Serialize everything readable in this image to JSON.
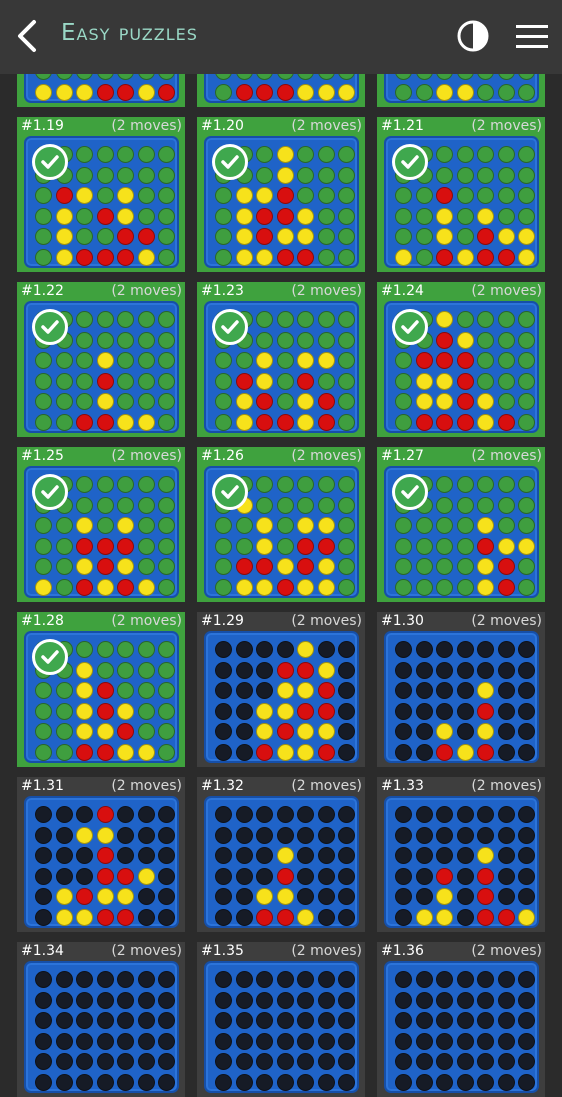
{
  "header": {
    "title": "Easy puzzles"
  },
  "colors": {
    "solved_bg": "#3fa23e",
    "unsolved_bg": "#3e3e3e",
    "board_blue": "#1f63c8",
    "red": "#d80f0f",
    "yellow": "#f7e21b",
    "title": "#9ad8c6"
  },
  "icons": {
    "back": "chevron-left-icon",
    "contrast": "contrast-icon",
    "menu": "hamburger-menu-icon",
    "solved": "check-circle-icon"
  },
  "puzzles": [
    {
      "number": "",
      "moves": "",
      "solved": true,
      "board": [
        "eeeeeee",
        "eeeeeee",
        "eeeeeee",
        "eeeeeee",
        "eeeeeee",
        "yyyrryr"
      ]
    },
    {
      "number": "",
      "moves": "",
      "solved": true,
      "board": [
        "eeeeeee",
        "eeeeeee",
        "eeeeeee",
        "eeeeeee",
        "eeeeeee",
        "errryyy"
      ]
    },
    {
      "number": "",
      "moves": "",
      "solved": true,
      "board": [
        "eeeeeee",
        "eeeeeee",
        "eeeeeee",
        "eeeeeee",
        "eeeeeee",
        "eeyyeee"
      ]
    },
    {
      "number": "#1.19",
      "moves": "(2 moves)",
      "solved": true,
      "board": [
        "eeeeeee",
        "eeeeeee",
        "eryeyee",
        "eyeryee",
        "eyeerre",
        "eyrrrye"
      ]
    },
    {
      "number": "#1.20",
      "moves": "(2 moves)",
      "solved": true,
      "board": [
        "eeeyeee",
        "eeeyeee",
        "eyyreee",
        "eyrryee",
        "eyryyee",
        "eyyrree"
      ]
    },
    {
      "number": "#1.21",
      "moves": "(2 moves)",
      "solved": true,
      "board": [
        "eeeeeee",
        "eeeeeee",
        "eereeee",
        "eeyeyee",
        "eeyeryy",
        "yeryrry"
      ]
    },
    {
      "number": "#1.22",
      "moves": "(2 moves)",
      "solved": true,
      "board": [
        "eeeeeee",
        "eeeeeee",
        "eeeyeee",
        "eeereee",
        "eeeyeee",
        "eerryye"
      ]
    },
    {
      "number": "#1.23",
      "moves": "(2 moves)",
      "solved": true,
      "board": [
        "eeeeeee",
        "eeeeeee",
        "eeyeyye",
        "eryeree",
        "eyreyre",
        "eyrryre"
      ]
    },
    {
      "number": "#1.24",
      "moves": "(2 moves)",
      "solved": true,
      "board": [
        "eeyeeee",
        "eeryeee",
        "errreee",
        "eyyreee",
        "eyyryee",
        "errryre"
      ]
    },
    {
      "number": "#1.25",
      "moves": "(2 moves)",
      "solved": true,
      "board": [
        "eeeeeee",
        "eeeeeee",
        "eeyeyee",
        "eerrree",
        "eeyryee",
        "yeryrye"
      ]
    },
    {
      "number": "#1.26",
      "moves": "(2 moves)",
      "solved": true,
      "board": [
        "eeeeeee",
        "eyeeeee",
        "eeyeyye",
        "eeyerre",
        "erryrye",
        "eyyryye"
      ]
    },
    {
      "number": "#1.27",
      "moves": "(2 moves)",
      "solved": true,
      "board": [
        "eeeeeee",
        "eeeeeee",
        "eeeeyee",
        "eeeeryy",
        "eeeeyre",
        "eeeeyre"
      ]
    },
    {
      "number": "#1.28",
      "moves": "(2 moves)",
      "solved": true,
      "board": [
        "eeeeeee",
        "eeyeeee",
        "eeyreee",
        "eeyryee",
        "eeyyree",
        "eerryye"
      ]
    },
    {
      "number": "#1.29",
      "moves": "(2 moves)",
      "solved": false,
      "board": [
        "eeeeyee",
        "eeerrye",
        "eeeyyre",
        "eeyyrre",
        "eeyryye",
        "eeryyre"
      ]
    },
    {
      "number": "#1.30",
      "moves": "(2 moves)",
      "solved": false,
      "board": [
        "eeeeeee",
        "eeeeeee",
        "eeeeyee",
        "eeeereee",
        "eeyeyee",
        "eeryree"
      ]
    },
    {
      "number": "#1.31",
      "moves": "(2 moves)",
      "solved": false,
      "board": [
        "eeereee",
        "eeyyeee",
        "eeereee",
        "eeerrye",
        "eyryyee",
        "eyyrree"
      ]
    },
    {
      "number": "#1.32",
      "moves": "(2 moves)",
      "solved": false,
      "board": [
        "eeeeeee",
        "eeeeeee",
        "eeeyeee",
        "eeereee",
        "eeyyeee",
        "eerryee"
      ]
    },
    {
      "number": "#1.33",
      "moves": "(2 moves)",
      "solved": false,
      "board": [
        "eeeeeee",
        "eeeeeee",
        "eeeeyee",
        "eereree",
        "eeyeree",
        "eyyerry"
      ]
    },
    {
      "number": "#1.34",
      "moves": "(2 moves)",
      "solved": false,
      "board": [
        "eeeeeee",
        "eeeeeee",
        "eeeeeee",
        "eeeeeee",
        "eeeeeee",
        "eeeeeee"
      ]
    },
    {
      "number": "#1.35",
      "moves": "(2 moves)",
      "solved": false,
      "board": [
        "eeeeeee",
        "eeeeeee",
        "eeeeeee",
        "eeeeeee",
        "eeeeeee",
        "eeeeeee"
      ]
    },
    {
      "number": "#1.36",
      "moves": "(2 moves)",
      "solved": false,
      "board": [
        "eeeeeee",
        "eeeeeee",
        "eeeeeee",
        "eeeeeee",
        "eeeeeee",
        "eeeeeee"
      ]
    }
  ]
}
